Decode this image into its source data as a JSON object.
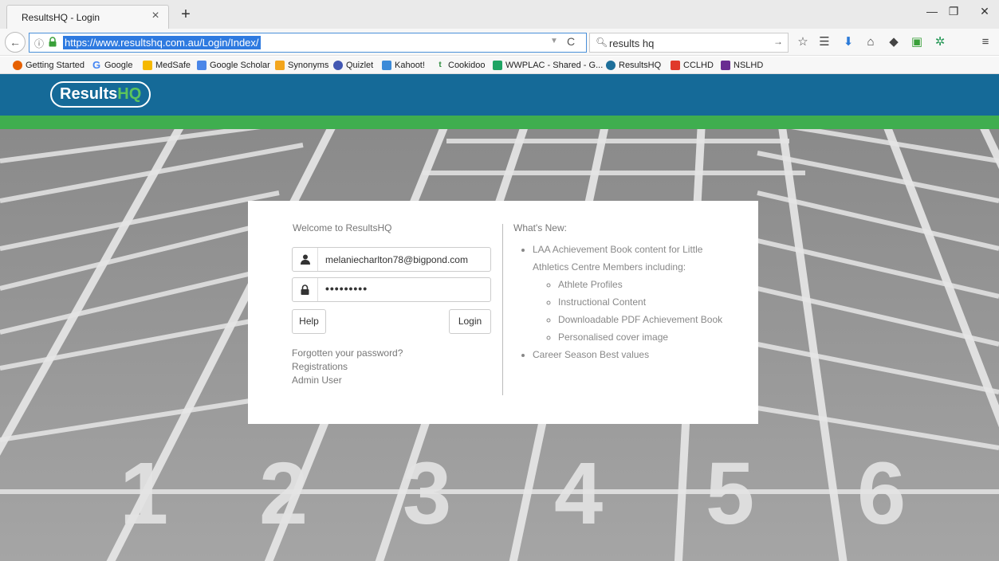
{
  "browser": {
    "tab_title": "ResultsHQ - Login",
    "tab_close": "×",
    "new_tab": "+",
    "url": "https://www.resultshq.com.au/Login/Index/",
    "search_query": "results hq",
    "bookmarks": [
      {
        "label": "Getting Started",
        "icon": "firefox-icon",
        "color": "#e66000"
      },
      {
        "label": "Google",
        "icon": "google-icon",
        "color": "#4285f4"
      },
      {
        "label": "MedSafe",
        "icon": "medsafe-icon",
        "color": "#f5b800"
      },
      {
        "label": "Google Scholar",
        "icon": "scholar-icon",
        "color": "#4a86e8"
      },
      {
        "label": "Synonyms",
        "icon": "synonyms-icon",
        "color": "#f3a51c"
      },
      {
        "label": "Quizlet",
        "icon": "quizlet-icon",
        "color": "#4257b2"
      },
      {
        "label": "Kahoot!",
        "icon": "kahoot-icon",
        "color": "#3c8ad8"
      },
      {
        "label": "Cookidoo",
        "icon": "cookidoo-icon",
        "color": "#2a8a3a"
      },
      {
        "label": "WWPLAC - Shared - G...",
        "icon": "drive-icon",
        "color": "#1fa463"
      },
      {
        "label": "ResultsHQ",
        "icon": "resultshq-icon",
        "color": "#1e6f9a"
      },
      {
        "label": "CCLHD",
        "icon": "cclhd-icon",
        "color": "#e0392b"
      },
      {
        "label": "NSLHD",
        "icon": "nslhd-icon",
        "color": "#6a2c91"
      }
    ]
  },
  "site": {
    "logo_results": "Results",
    "logo_hq": "HQ",
    "colors": {
      "header": "#156a98",
      "strip": "#3fae4f"
    }
  },
  "login": {
    "welcome": "Welcome to ResultsHQ",
    "email": "melaniecharlton78@bigpond.com",
    "password_mask": "•••••••••",
    "help_label": "Help",
    "login_label": "Login",
    "forgot_label": "Forgotten your password?",
    "registrations_label": "Registrations",
    "admin_label": "Admin User"
  },
  "whats_new": {
    "title": "What's New:",
    "item1": "LAA Achievement Book content for Little Athletics Centre Members including:",
    "subitems": [
      "Athlete Profiles",
      "Instructional Content",
      "Downloadable PDF Achievement Book",
      "Personalised cover image"
    ],
    "item2": "Career Season Best values"
  },
  "hero": {
    "lane_numbers": [
      "1",
      "2",
      "3",
      "4",
      "5",
      "6"
    ]
  }
}
